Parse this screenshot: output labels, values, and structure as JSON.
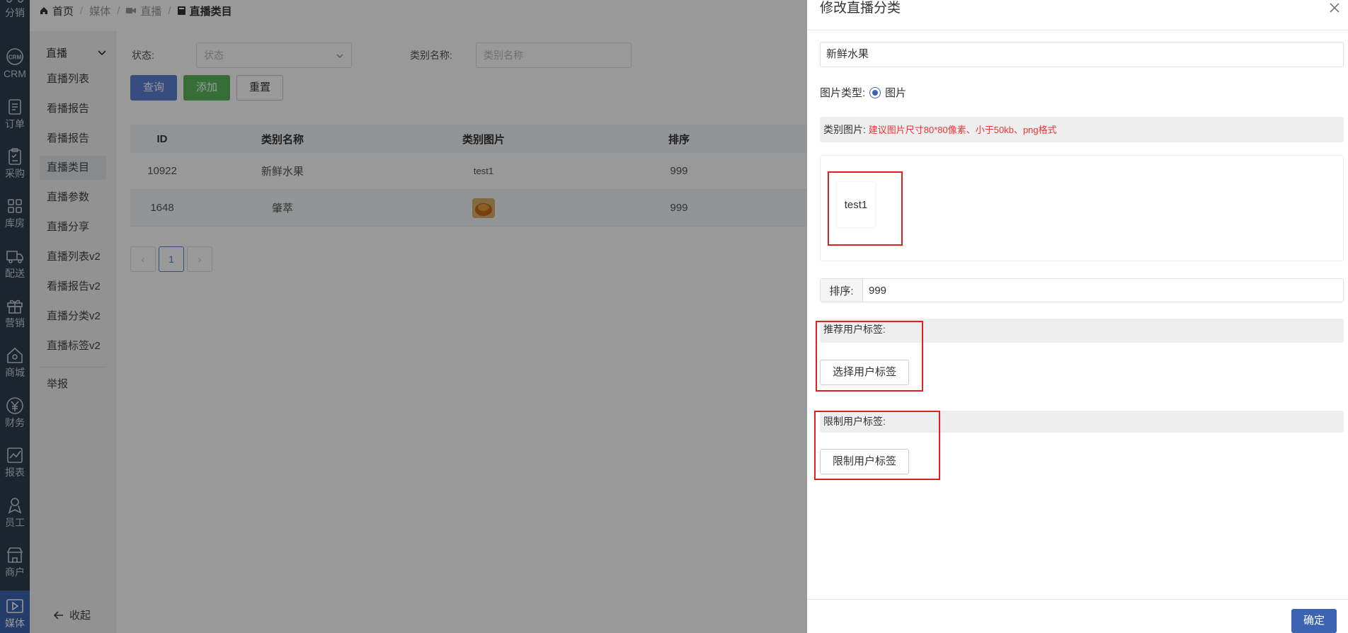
{
  "sidebar": {
    "items": [
      {
        "label": "分销",
        "icon": "share-network-icon"
      },
      {
        "label": "CRM",
        "icon": "crm-icon"
      },
      {
        "label": "订单",
        "icon": "document-icon"
      },
      {
        "label": "采购",
        "icon": "clipboard-icon"
      },
      {
        "label": "库房",
        "icon": "warehouse-icon"
      },
      {
        "label": "配送",
        "icon": "truck-icon"
      },
      {
        "label": "营销",
        "icon": "gift-icon"
      },
      {
        "label": "商城",
        "icon": "home-icon"
      },
      {
        "label": "财务",
        "icon": "yen-icon"
      },
      {
        "label": "报表",
        "icon": "chart-icon"
      },
      {
        "label": "员工",
        "icon": "user-badge-icon"
      },
      {
        "label": "商户",
        "icon": "shop-icon"
      },
      {
        "label": "媒体",
        "icon": "play-icon"
      }
    ],
    "active_index": 12
  },
  "submenu": {
    "group": "直播",
    "items": [
      "直播列表",
      "看播报告",
      "看播报告",
      "直播类目",
      "直播参数",
      "直播分享",
      "直播列表v2",
      "看播报告v2",
      "直播分类v2",
      "直播标签v2"
    ],
    "active_index": 3,
    "extra": "举报",
    "collapse": "收起"
  },
  "breadcrumb": {
    "home": "首页",
    "media": "媒体",
    "live": "直播",
    "current": "直播类目"
  },
  "filter": {
    "status_label": "状态:",
    "status_placeholder": "状态",
    "name_label": "类别名称:",
    "name_placeholder": "类别名称",
    "query": "查询",
    "add": "添加",
    "reset": "重置"
  },
  "table": {
    "headers": [
      "ID",
      "类别名称",
      "类别图片",
      "排序"
    ],
    "rows": [
      {
        "id": "10922",
        "name": "新鲜水果",
        "image": "test1",
        "sort": "999"
      },
      {
        "id": "1648",
        "name": "肇萃",
        "image": "",
        "sort": "999"
      }
    ]
  },
  "pagination": {
    "current": "1",
    "prev": "‹",
    "next": "›"
  },
  "drawer": {
    "title": "修改直播分类",
    "name_value": "新鲜水果",
    "image_type_label": "图片类型:",
    "image_type_option": "图片",
    "image_label": "类别图片:",
    "image_hint": "建议图片尺寸80*80像素、小于50kb、png格式",
    "image_thumb_text": "test1",
    "sort_label": "排序:",
    "sort_value": "999",
    "recommend_label": "推荐用户标签:",
    "recommend_button": "选择用户标签",
    "restrict_label": "限制用户标签:",
    "restrict_button": "限制用户标签",
    "confirm": "确定"
  },
  "colors": {
    "sidebar_bg": "#2f3d4e",
    "accent": "#3c64b1",
    "success": "#5cb85c",
    "highlight_box": "#e02020"
  }
}
